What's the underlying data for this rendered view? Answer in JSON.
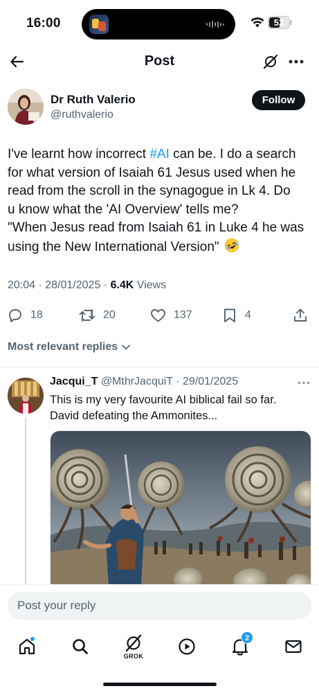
{
  "status_bar": {
    "time": "16:00",
    "battery": "52"
  },
  "header": {
    "title": "Post"
  },
  "post": {
    "author_name": "Dr Ruth Valerio",
    "author_handle": "@ruthvalerio",
    "follow_label": "Follow",
    "text_line1_pre": "I've learnt how incorrect ",
    "hashtag": "#AI",
    "text_line1_post": " can be. I do a search",
    "text_line2": "for what version of Isaiah 61 Jesus used when he",
    "text_line3": "read from the scroll in the synagogue in Lk 4. Do",
    "text_line4": "u know what the 'AI Overview' tells me?",
    "text_line5": "\"When Jesus read from Isaiah 61 in Luke 4 he was",
    "text_line6": "using the New International Version\"",
    "emoji": "rofl-emoji-icon",
    "timestamp": "20:04 · 28/01/2025 · ",
    "views_count": "6.4K",
    "views_label": " Views"
  },
  "actions": {
    "replies": "18",
    "reposts": "20",
    "likes": "137",
    "bookmarks": "4"
  },
  "replies_filter": {
    "label": "Most relevant replies"
  },
  "reply": {
    "name": "Jacqui_T",
    "handle": "@MthrJacquiT",
    "date": " · 29/01/2025",
    "text_line1": "This is my very favourite AI biblical fail so far.",
    "text_line2": "David defeating the Ammonites..."
  },
  "composer": {
    "placeholder": "Post your reply"
  },
  "tab_bar": {
    "grok_label": "GROK",
    "notifications_count": "2"
  },
  "colors": {
    "accent": "#1d9bf0",
    "text_primary": "#0f1419",
    "text_secondary": "#536471"
  }
}
